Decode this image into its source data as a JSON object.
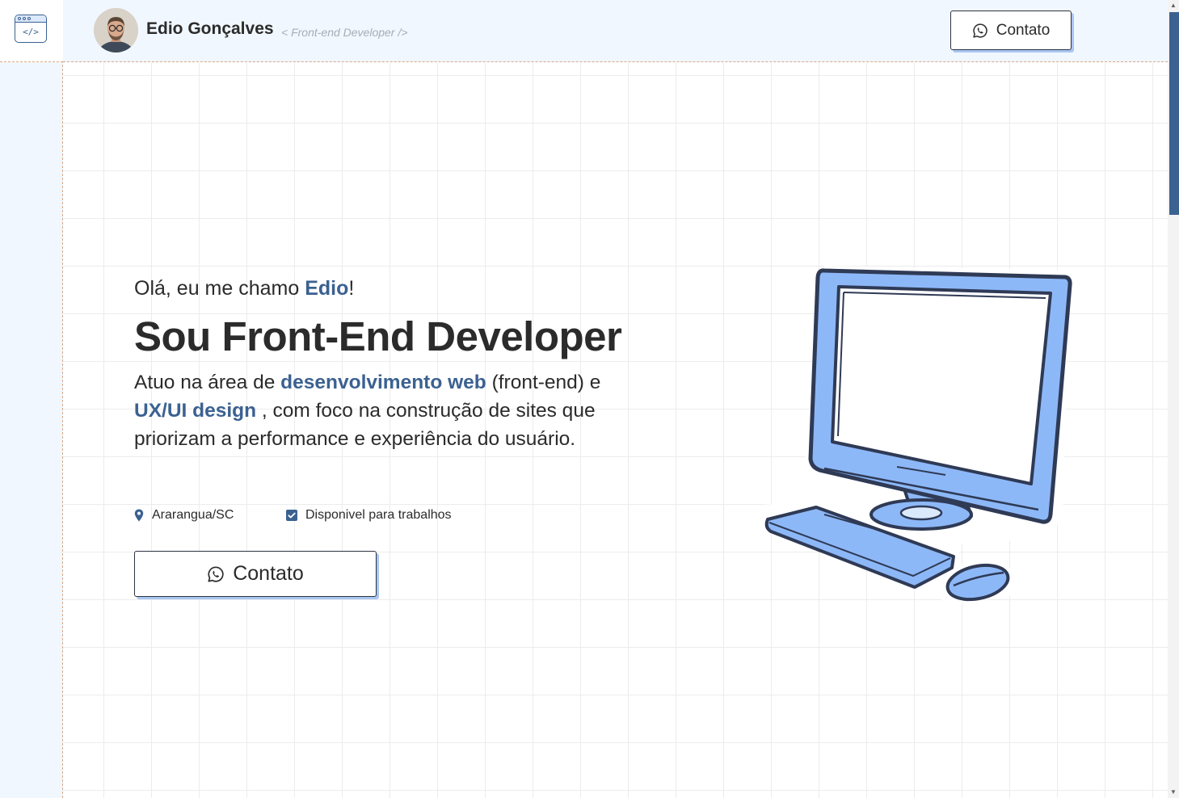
{
  "header": {
    "name": "Edio Gonçalves",
    "role": "< Front-end Developer />",
    "contact_label": "Contato"
  },
  "hero": {
    "greeting_prefix": "Olá, eu me chamo ",
    "greeting_name": "Edio",
    "greeting_suffix": "!",
    "headline": "Sou Front-End Developer",
    "description": {
      "part1": "Atuo na área de ",
      "highlight1": "desenvolvimento web",
      "part2": " (front-end) e ",
      "highlight2": "UX/UI design",
      "part3": " , com foco na construção de sites que priorizam a performance e experiência do usuário."
    },
    "location": "Ararangua/SC",
    "availability": "Disponivel para trabalhos",
    "contact_label": "Contato"
  },
  "logo": {
    "code_glyph": "</>"
  },
  "colors": {
    "accent": "#3b6191",
    "light_blue": "#8db8f8",
    "panel_bg": "#f1f7fe",
    "text": "#2b2b2b"
  },
  "icons": {
    "logo": "code-window-icon",
    "contact": "whatsapp-icon",
    "location": "map-pin-icon",
    "availability": "checkbox-checked-icon"
  }
}
